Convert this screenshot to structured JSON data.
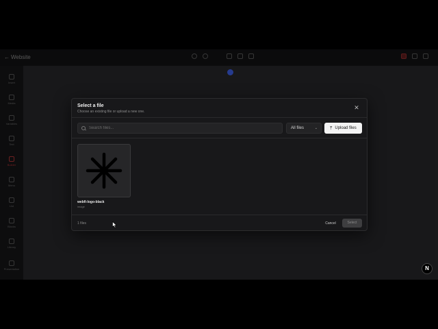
{
  "app": {
    "back_label": "Website",
    "sidebar": [
      {
        "label": "Insert"
      },
      {
        "label": "Media"
      },
      {
        "label": "Variables"
      },
      {
        "label": "Text"
      },
      {
        "label": "Builder"
      },
      {
        "label": "Menu"
      },
      {
        "label": "List"
      },
      {
        "label": "Blocks"
      },
      {
        "label": "Library"
      },
      {
        "label": "Presentation"
      }
    ],
    "badge": "N"
  },
  "modal": {
    "title": "Select a file",
    "subtitle": "Choose an existing file or upload a new one.",
    "close_icon": "close-icon",
    "search": {
      "placeholder": "Search files...",
      "value": ""
    },
    "filter": {
      "selected": "All files"
    },
    "upload_label": "Upload files",
    "files": [
      {
        "name": "webfi-logo-black",
        "meta": "image"
      }
    ],
    "count_label": "1 files",
    "cancel_label": "Cancel",
    "select_label": "Select"
  }
}
